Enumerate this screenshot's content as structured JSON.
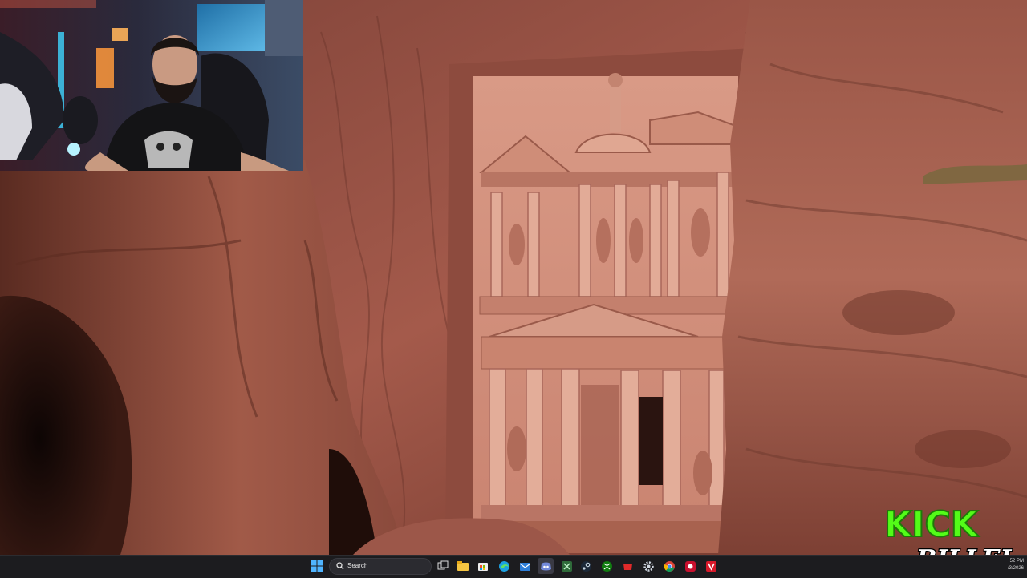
{
  "taskbar": {
    "search_label": "Search",
    "tray": {
      "time": "52 PM",
      "date": "/3/2026"
    }
  },
  "overlay": {
    "logo_text": "KICK",
    "streamer_name": "BILLEH"
  },
  "colors": {
    "kick_green": "#53fc18",
    "taskbar_bg": "#1c1c1f",
    "sandstone": "#b8695a"
  },
  "icons": [
    "windows-start-icon",
    "search-icon",
    "task-view-icon",
    "file-explorer-icon",
    "store-icon",
    "edge-icon",
    "mail-icon",
    "discord-icon",
    "xbox-icon",
    "steam-icon",
    "xbox-app-icon",
    "game-launcher-icon",
    "settings-icon",
    "chrome-icon",
    "app-red-icon",
    "app-v-icon"
  ]
}
